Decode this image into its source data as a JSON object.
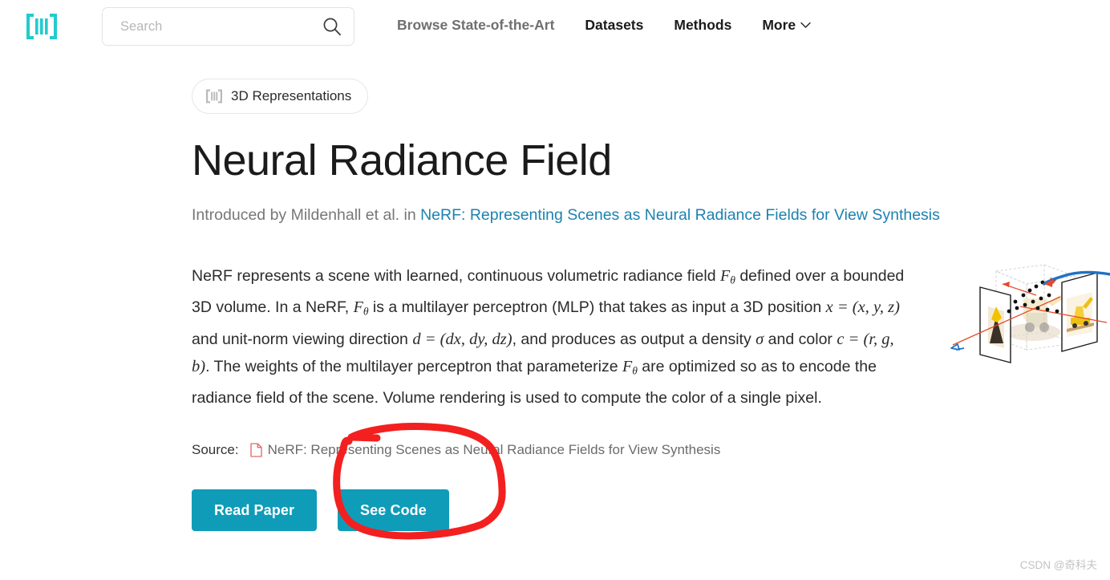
{
  "header": {
    "logo_icon": "paperswithcode-logo-icon",
    "logo_color": "#21cbce",
    "search": {
      "placeholder": "Search",
      "value": "",
      "icon": "search-icon"
    },
    "nav": [
      {
        "label": "Browse State-of-the-Art",
        "muted": true,
        "chevron": false
      },
      {
        "label": "Datasets",
        "muted": false,
        "chevron": false
      },
      {
        "label": "Methods",
        "muted": false,
        "chevron": false
      },
      {
        "label": "More",
        "muted": false,
        "chevron": true
      }
    ]
  },
  "badge": {
    "icon": "category-logo-icon",
    "label": "3D Representations"
  },
  "page": {
    "title": "Neural Radiance Field",
    "subtitle_prefix": "Introduced by Mildenhall et al. in ",
    "subtitle_link": "NeRF: Representing Scenes as Neural Radiance Fields for View Synthesis",
    "link_color": "#1c82b0"
  },
  "description": {
    "p1": "NeRF represents a scene with learned, continuous volumetric radiance field ",
    "m1_base": "F",
    "m1_sub": "θ",
    "p2": " defined over a bounded 3D volume. In a NeRF, ",
    "m2_base": "F",
    "m2_sub": "θ",
    "p3": " is a multilayer perceptron (MLP) that takes as input a 3D position ",
    "m3": "x = (x, y, z)",
    "p4": " and unit-norm viewing direction ",
    "m4": "d = (dx, dy, dz)",
    "p5": ", and produces as output a density ",
    "m5": "σ",
    "p6": " and color ",
    "m6": "c = (r, g, b)",
    "p7": ". The weights of the multilayer perceptron that parameterize ",
    "m7_base": "F",
    "m7_sub": "θ",
    "p8": " are optimized so as to encode the radiance field of the scene. Volume rendering is used to compute the color of a single pixel."
  },
  "source": {
    "label": "Source:",
    "icon": "document-icon",
    "icon_color": "#e06a6a",
    "link": "NeRF: Representing Scenes as Neural Radiance Fields for View Synthesis"
  },
  "actions": {
    "accent_color": "#0f9cb8",
    "read_paper": "Read Paper",
    "see_code": "See Code"
  },
  "annotation": {
    "shape": "hand-drawn-red-circle",
    "color": "#f32020",
    "targets": "see-code-button"
  },
  "diagram": {
    "name": "nerf-ray-sampling-diagram",
    "ray_color": "#e8472a",
    "curve_color": "#1f72c4"
  },
  "watermark": {
    "text": "CSDN @奇科夫"
  }
}
